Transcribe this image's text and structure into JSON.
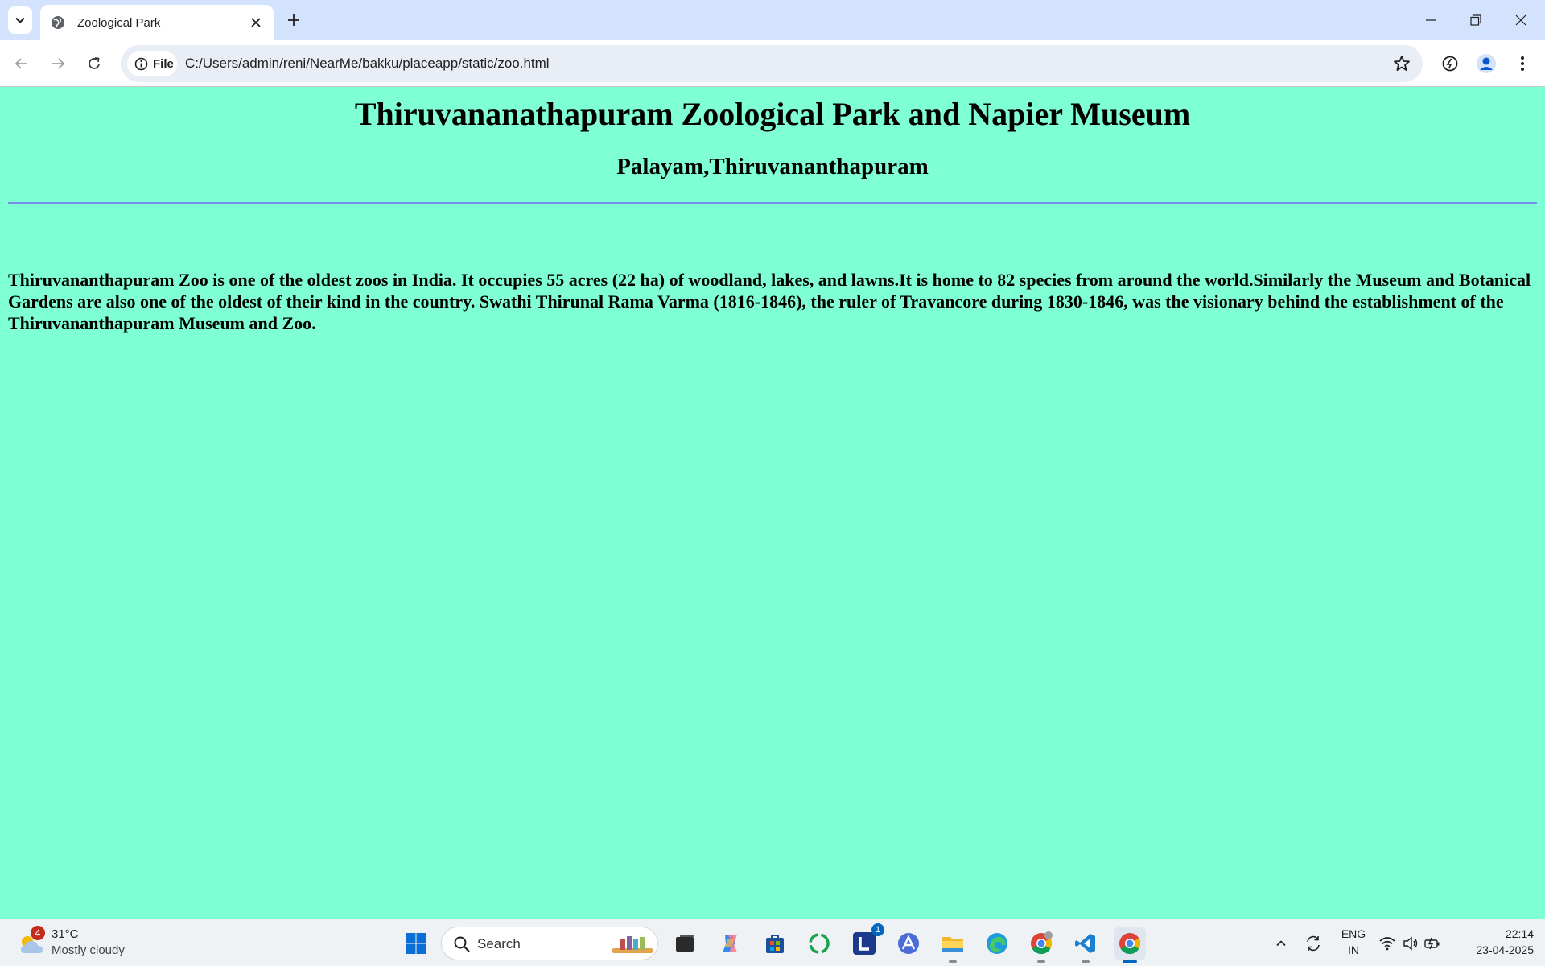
{
  "browser": {
    "tab_title": "Zoological Park",
    "address_chip": "File",
    "url": "C:/Users/admin/reni/NearMe/bakku/placeapp/static/zoo.html"
  },
  "page": {
    "title": "Thiruvananathapuram Zoological Park and Napier Museum",
    "subtitle": "Palayam,Thiruvananthapuram",
    "description": "Thiruvananthapuram Zoo is one of the oldest zoos in India. It occupies 55 acres (22 ha) of woodland, lakes, and lawns.It is home to 82 species from around the world.Similarly the Museum and Botanical Gardens are also one of the oldest of their kind in the country. Swathi Thirunal Rama Varma (1816-1846), the ruler of Travancore during 1830-1846, was the visionary behind the establishment of the Thiruvananthapuram Museum and Zoo.",
    "background_color": "#7fffd4",
    "rule_color": "#7a8ae8"
  },
  "taskbar": {
    "weather": {
      "temp": "31°C",
      "condition": "Mostly cloudy",
      "badge": "4"
    },
    "search_label": "Search",
    "launcher_badge": "1",
    "language": {
      "line1": "ENG",
      "line2": "IN"
    },
    "clock": {
      "time": "22:14",
      "date": "23-04-2025"
    }
  }
}
